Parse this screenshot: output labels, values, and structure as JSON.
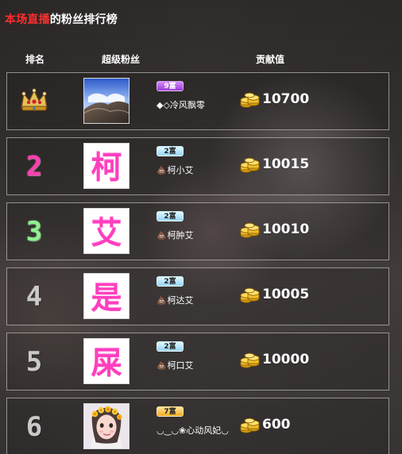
{
  "header": {
    "title_highlight": "本场直播",
    "title_rest": "的粉丝排行榜"
  },
  "columns": {
    "rank": "排名",
    "fan": "超级粉丝",
    "contribution": "贡献值"
  },
  "rows": [
    {
      "rank_text": "",
      "rank_icon": "crown-icon",
      "badge": "9富",
      "badge_color": "#b14ae6",
      "name": "◆◇冷风飘零",
      "name_icon": "",
      "avatar_type": "scenic",
      "avatar_char": "",
      "score": "10700"
    },
    {
      "rank_text": "2",
      "rank_icon": "",
      "badge": "2富",
      "badge_color": "#8ecff3",
      "name": "柯小艾",
      "name_icon": "poop-icon",
      "avatar_type": "char",
      "avatar_char": "柯",
      "score": "10015"
    },
    {
      "rank_text": "3",
      "rank_icon": "",
      "badge": "2富",
      "badge_color": "#8ecff3",
      "name": "柯肿艾",
      "name_icon": "poop-icon",
      "avatar_type": "char",
      "avatar_char": "艾",
      "score": "10010"
    },
    {
      "rank_text": "4",
      "rank_icon": "",
      "badge": "2富",
      "badge_color": "#8ecff3",
      "name": "柯达艾",
      "name_icon": "poop-icon",
      "avatar_type": "char",
      "avatar_char": "是",
      "score": "10005"
    },
    {
      "rank_text": "5",
      "rank_icon": "",
      "badge": "2富",
      "badge_color": "#8ecff3",
      "name": "柯口艾",
      "name_icon": "poop-icon",
      "avatar_type": "char",
      "avatar_char": "屎",
      "score": "10000"
    },
    {
      "rank_text": "6",
      "rank_icon": "",
      "badge": "7富",
      "badge_color": "#f3b12c",
      "name": "◡‿◡❀心动风妃◡",
      "name_icon": "",
      "avatar_type": "girl",
      "avatar_char": "",
      "score": "600"
    }
  ]
}
